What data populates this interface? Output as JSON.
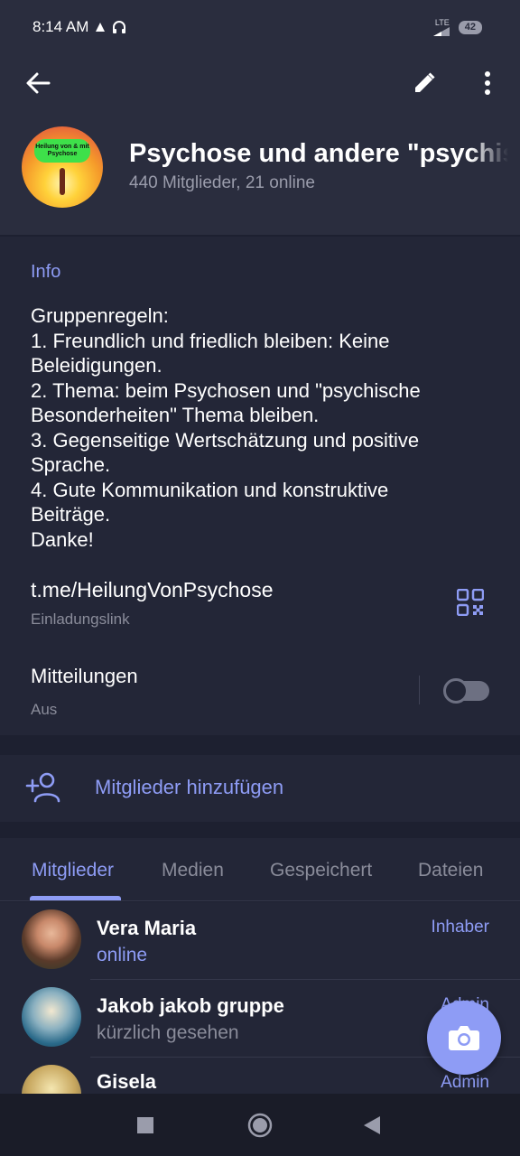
{
  "status_bar": {
    "time": "8:14 AM",
    "network": "LTE",
    "battery": "42"
  },
  "header": {
    "title": "Psychose und andere \"psychische Besonderheiten\"",
    "subtitle": "440 Mitglieder, 21 online",
    "avatar_badge": "Heilung von & mit Psychose"
  },
  "info": {
    "heading": "Info",
    "lines": [
      "Gruppenregeln:",
      "1. Freundlich und friedlich bleiben: Keine",
      "Beleidigungen.",
      "2. Thema: beim Psychosen und \"psychische",
      "Besonderheiten\" Thema bleiben.",
      "3. Gegenseitige Wertschätzung und positive",
      "Sprache.",
      "4. Gute Kommunikation und konstruktive",
      "Beiträge.",
      "Danke!"
    ],
    "link": "t.me/HeilungVonPsychose",
    "link_label": "Einladungslink",
    "notifications_label": "Mitteilungen",
    "notifications_state": "Aus"
  },
  "add_members": {
    "label": "Mitglieder hinzufügen"
  },
  "tabs": [
    {
      "label": "Mitglieder",
      "active": true
    },
    {
      "label": "Medien",
      "active": false
    },
    {
      "label": "Gespeichert",
      "active": false
    },
    {
      "label": "Dateien",
      "active": false
    }
  ],
  "members": [
    {
      "name": "Vera Maria",
      "status": "online",
      "role": "Inhaber"
    },
    {
      "name": "Jakob jakob gruppe",
      "status": "kürzlich gesehen",
      "role": "Admin"
    },
    {
      "name": "Gisela",
      "status": "",
      "role": "Admin"
    }
  ],
  "colors": {
    "accent": "#8e9cf5",
    "background": "#1d2030",
    "surface": "#232637",
    "header": "#2a2d3e"
  }
}
